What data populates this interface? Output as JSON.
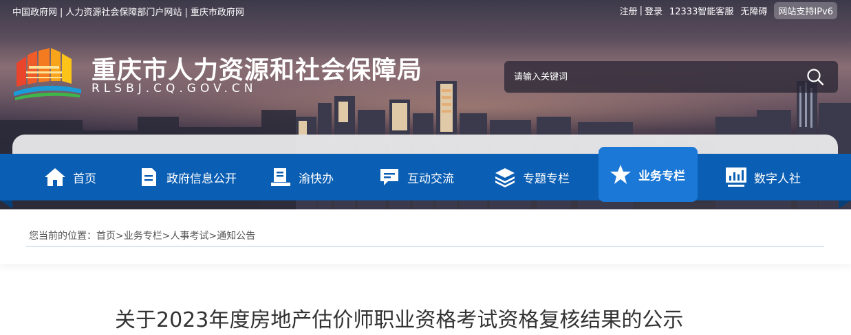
{
  "topbar": {
    "left_links": [
      "中国政府网",
      "人力资源社会保障部门户网站",
      "重庆市政府网"
    ],
    "register": "注册",
    "login": "登录",
    "service": "12333智能客服",
    "accessibility": "无障碍",
    "ipv6": "网站支持IPv6"
  },
  "header": {
    "title": "重庆市人力资源和社会保障局",
    "domain": "RLSBJ.CQ.GOV.CN"
  },
  "search": {
    "placeholder": "请输入关键词"
  },
  "nav": {
    "items": [
      {
        "label": "首页",
        "icon": "home-icon"
      },
      {
        "label": "政府信息公开",
        "icon": "document-icon"
      },
      {
        "label": "渝快办",
        "icon": "service-desk-icon"
      },
      {
        "label": "互动交流",
        "icon": "chat-icon"
      },
      {
        "label": "专题专栏",
        "icon": "layers-icon"
      },
      {
        "label": "业务专栏",
        "icon": "star-icon",
        "active": true
      },
      {
        "label": "数字人社",
        "icon": "monitor-chart-icon"
      }
    ]
  },
  "breadcrumb": {
    "prefix": "您当前的位置：",
    "items": [
      "首页",
      "业务专栏",
      "人事考试",
      "通知公告"
    ],
    "separator": ">"
  },
  "article": {
    "title": "关于2023年度房地产估价师职业资格考试资格复核结果的公示"
  },
  "colors": {
    "nav_bg": "#0a5eb3",
    "nav_active": "#1b78d6"
  }
}
